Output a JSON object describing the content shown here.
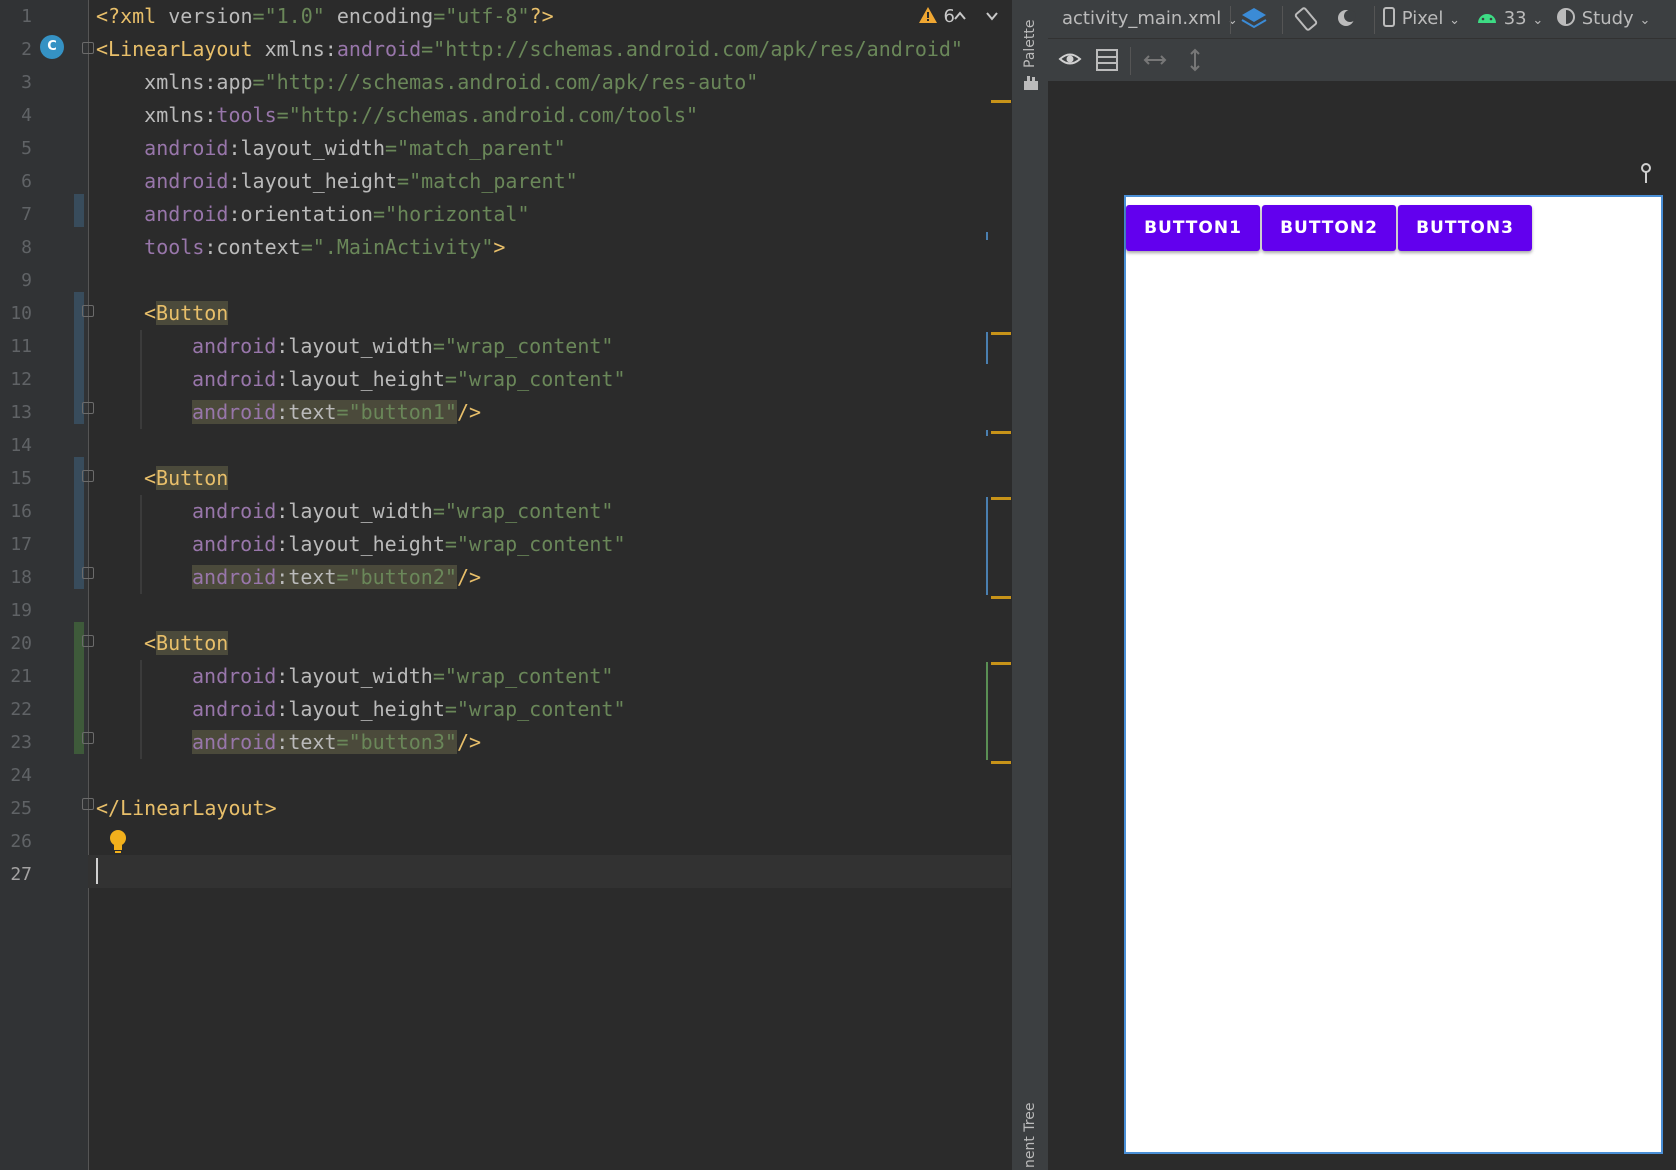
{
  "editor": {
    "line_numbers": [
      "1",
      "2",
      "3",
      "4",
      "5",
      "6",
      "7",
      "8",
      "9",
      "10",
      "11",
      "12",
      "13",
      "14",
      "15",
      "16",
      "17",
      "18",
      "19",
      "20",
      "21",
      "22",
      "23",
      "24",
      "25",
      "26",
      "27"
    ],
    "current_line": "27",
    "inspection_count": "6",
    "code": {
      "l1": {
        "a": "<?xml ",
        "b": "version",
        "c": "=",
        "d": "\"1.0\"",
        "e": " encoding",
        "f": "=",
        "g": "\"utf-8\"",
        "h": "?>"
      },
      "l2": {
        "a": "<LinearLayout ",
        "b": "xmlns:",
        "c": "android",
        "d": "=",
        "e": "\"http://schemas.android.com/apk/res/android\""
      },
      "l3": {
        "a": "    xmlns:",
        "b": "app",
        "c": "=",
        "d": "\"http://schemas.android.com/apk/res-auto\""
      },
      "l4": {
        "a": "    xmlns:",
        "b": "tools",
        "c": "=",
        "d": "\"http://schemas.android.com/tools\""
      },
      "l5": {
        "a": "    android",
        "b": ":layout_width",
        "c": "=",
        "d": "\"match_parent\""
      },
      "l6": {
        "a": "    android",
        "b": ":layout_height",
        "c": "=",
        "d": "\"match_parent\""
      },
      "l7": {
        "a": "    android",
        "b": ":orientation",
        "c": "=",
        "d": "\"horizontal\""
      },
      "l8": {
        "a": "    tools",
        "b": ":context",
        "c": "=",
        "d": "\".MainActivity\"",
        "e": ">"
      },
      "b1": {
        "open": "<",
        "tag": "Button",
        "w_ns": "android",
        "w_at": ":layout_width",
        "w_val": "\"wrap_content\"",
        "h_ns": "android",
        "h_at": ":layout_height",
        "h_val": "\"wrap_content\"",
        "t_ns": "android",
        "t_at": ":text",
        "t_val": "\"button1\"",
        "close": "/>"
      },
      "b2": {
        "open": "<",
        "tag": "Button",
        "w_ns": "android",
        "w_at": ":layout_width",
        "w_val": "\"wrap_content\"",
        "h_ns": "android",
        "h_at": ":layout_height",
        "h_val": "\"wrap_content\"",
        "t_ns": "android",
        "t_at": ":text",
        "t_val": "\"button2\"",
        "close": "/>"
      },
      "b3": {
        "open": "<",
        "tag": "Button",
        "w_ns": "android",
        "w_at": ":layout_width",
        "w_val": "\"wrap_content\"",
        "h_ns": "android",
        "h_at": ":layout_height",
        "h_val": "\"wrap_content\"",
        "t_ns": "android",
        "t_at": ":text",
        "t_val": "\"button3\"",
        "close": "/>"
      },
      "l25": "</LinearLayout>",
      "eq": "="
    }
  },
  "side_tabs": {
    "palette": "Palette",
    "component_tree": "nent Tree"
  },
  "design_toolbar": {
    "file": "activity_main.xml",
    "device": "Pixel",
    "api": "33",
    "theme": "Study"
  },
  "preview": {
    "buttons": [
      "BUTTON1",
      "BUTTON2",
      "BUTTON3"
    ],
    "button_color": "#6200ee"
  },
  "icons": [
    "warning-icon",
    "chevron-up-icon",
    "chevron-down-icon",
    "class-c-icon",
    "lightbulb-icon",
    "layers-icon",
    "orientation-icon",
    "night-mode-icon",
    "device-icon",
    "android-icon",
    "theme-icon",
    "eye-icon",
    "blueprint-icon",
    "pan-h-icon",
    "pan-v-icon",
    "pin-icon"
  ]
}
